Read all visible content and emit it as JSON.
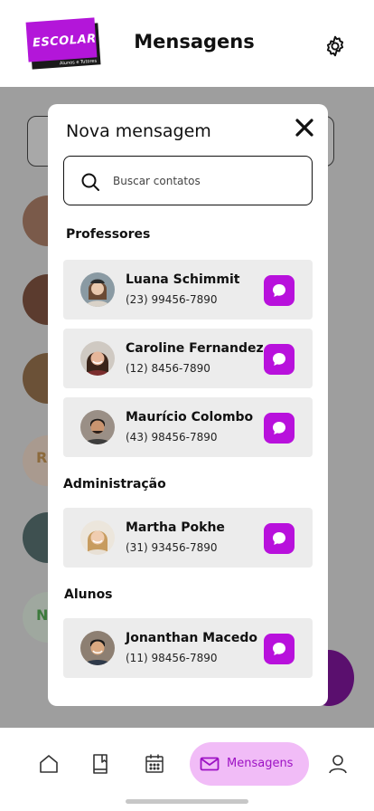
{
  "header": {
    "logo_text": "ESCOLAR",
    "logo_sub": "Alunos e Tutores",
    "title": "Mensagens",
    "icons": {
      "settings": "gear-icon"
    }
  },
  "modal": {
    "title": "Nova mensagem",
    "close_icon": "close-icon",
    "search": {
      "placeholder": "Buscar contatos",
      "value": ""
    },
    "sections": [
      {
        "title": "Professores",
        "contacts": [
          {
            "name": "Luana Schimmit",
            "phone": "(23) 99456-7890"
          },
          {
            "name": "Caroline Fernandez",
            "phone": "(12) 8456-7890"
          },
          {
            "name": "Maurício Colombo",
            "phone": "(43) 98456-7890"
          }
        ]
      },
      {
        "title": "Administração",
        "contacts": [
          {
            "name": "Martha Pokhe",
            "phone": "(31) 93456-7890"
          }
        ]
      },
      {
        "title": "Alunos",
        "contacts": [
          {
            "name": "Jonanthan Macedo",
            "phone": "(11) 98456-7890"
          }
        ]
      }
    ]
  },
  "background": {
    "initials": [
      "R",
      "N"
    ]
  },
  "nav": {
    "items": [
      "home-icon",
      "book-icon",
      "calendar-icon",
      "mail-icon",
      "user-icon"
    ],
    "active_label": "Mensagens"
  },
  "colors": {
    "accent": "#b811dc",
    "active_pill": "#f1bcf7",
    "overlay": "#9e9e9e"
  }
}
